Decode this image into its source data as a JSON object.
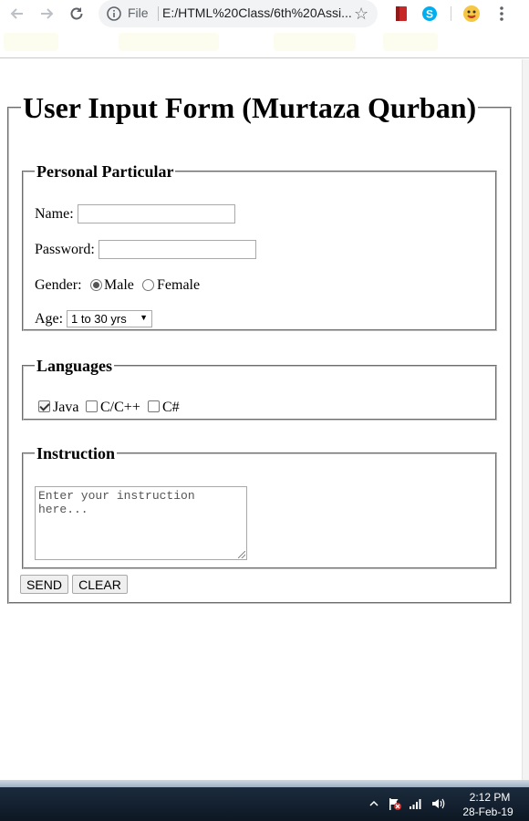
{
  "browser": {
    "url_scheme_label": "File",
    "url": "E:/HTML%20Class/6th%20Assi..."
  },
  "form": {
    "title": "User Input Form (Murtaza Qurban)",
    "personal": {
      "legend": "Personal Particular",
      "name_label": "Name:",
      "name_value": "",
      "password_label": "Password:",
      "password_value": "",
      "gender_label": "Gender:",
      "gender_options": [
        "Male",
        "Female"
      ],
      "gender_selected": "Male",
      "age_label": "Age:",
      "age_selected": "1 to 30 yrs"
    },
    "languages": {
      "legend": "Languages",
      "options": [
        {
          "label": "Java",
          "checked": true
        },
        {
          "label": "C/C++",
          "checked": false
        },
        {
          "label": "C#",
          "checked": false
        }
      ]
    },
    "instruction": {
      "legend": "Instruction",
      "placeholder": "Enter your instruction here..."
    },
    "buttons": {
      "send": "SEND",
      "clear": "CLEAR"
    }
  },
  "taskbar": {
    "time": "2:12 PM",
    "date": "28-Feb-19"
  },
  "colors": {
    "taskbar": "#14202e",
    "omnibox": "#f1f3f4",
    "fieldset_border": "#888888"
  }
}
